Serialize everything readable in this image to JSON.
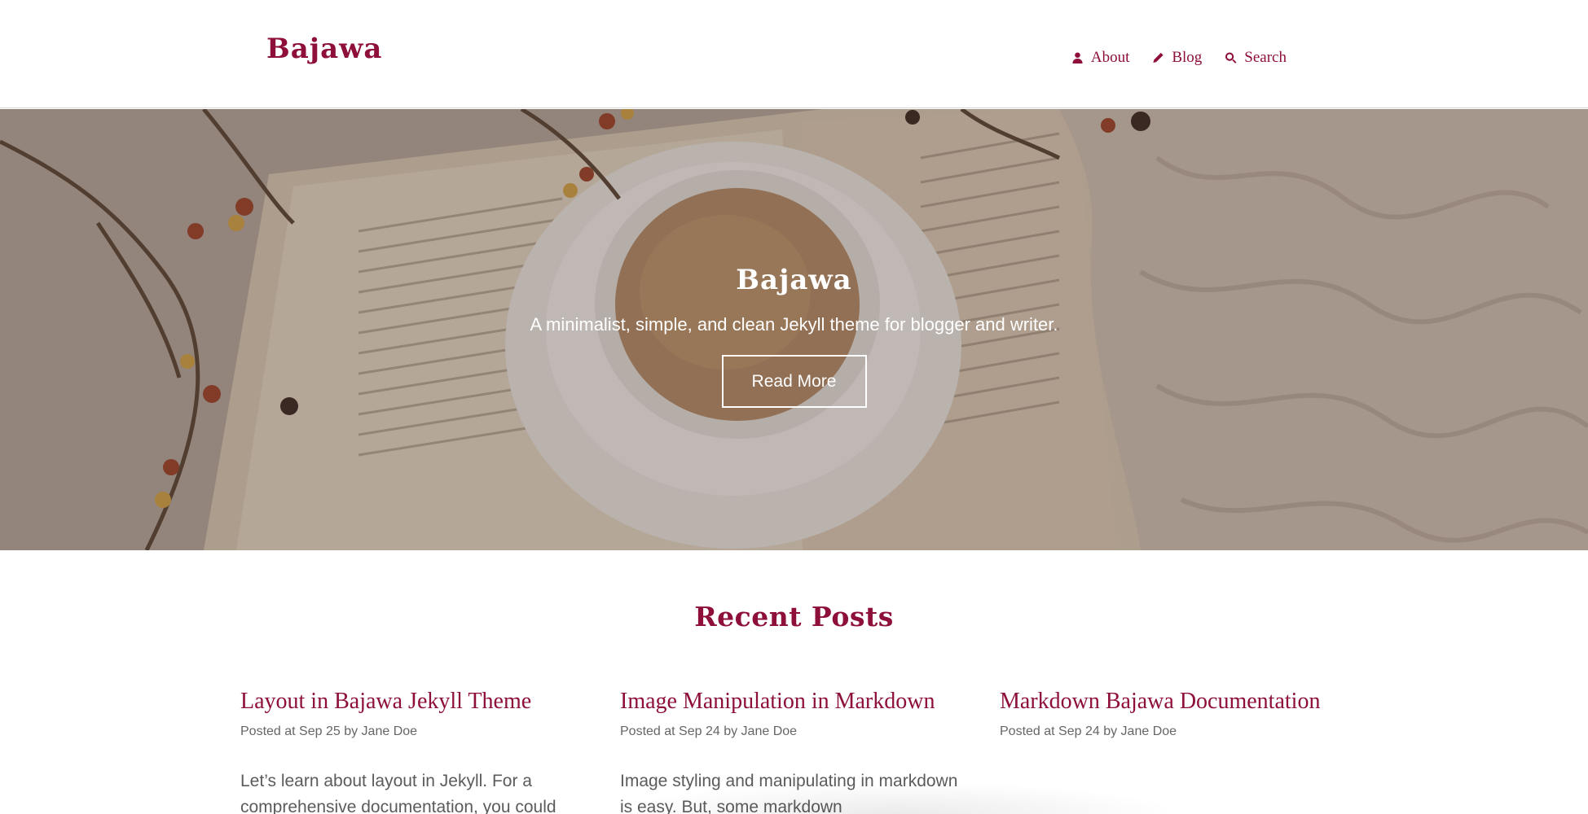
{
  "header": {
    "brand": "Bajawa",
    "nav": [
      {
        "label": "About",
        "icon": "user-icon"
      },
      {
        "label": "Blog",
        "icon": "pencil-icon"
      },
      {
        "label": "Search",
        "icon": "search-icon"
      }
    ]
  },
  "hero": {
    "title": "Bajawa",
    "subtitle": "A minimalist, simple, and clean Jekyll theme for blogger and writer.",
    "button": "Read More"
  },
  "recent": {
    "title": "Recent Posts",
    "posts": [
      {
        "title": "Layout in Bajawa Jekyll Theme",
        "meta": "Posted at Sep 25 by Jane Doe",
        "excerpt": "Let’s learn about layout in Jekyll. For a comprehensive documentation, you could"
      },
      {
        "title": "Image Manipulation in Markdown",
        "meta": "Posted at Sep 24 by Jane Doe",
        "excerpt": "Image styling and manipulating in markdown is easy. But, some markdown"
      },
      {
        "title": "Markdown Bajawa Documentation",
        "meta": "Posted at Sep 24 by Jane Doe",
        "excerpt": ""
      }
    ]
  },
  "colors": {
    "brand": "#8d0f3a",
    "text": "#555555"
  }
}
